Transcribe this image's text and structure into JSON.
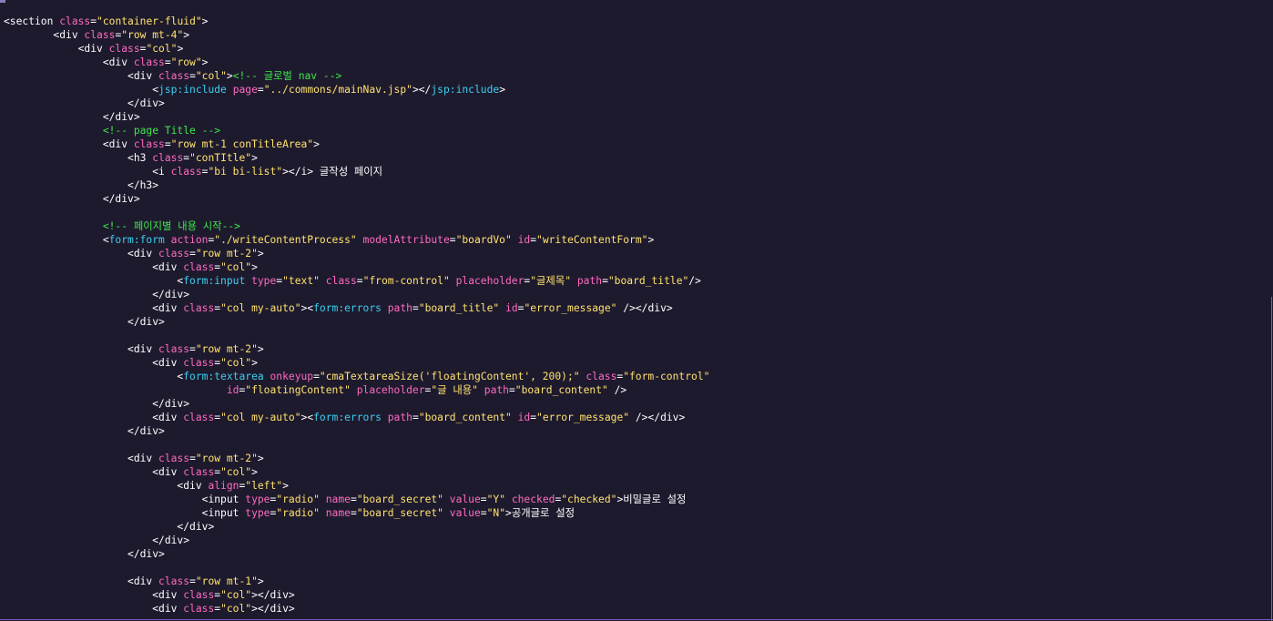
{
  "editor": {
    "lines": [
      [
        [
          "t",
          "<section "
        ],
        [
          "a",
          "class"
        ],
        [
          "t",
          "="
        ],
        [
          "s",
          "\"container-fluid\""
        ],
        [
          "t",
          ">"
        ]
      ],
      [
        [
          "t",
          "        <div "
        ],
        [
          "a",
          "class"
        ],
        [
          "t",
          "="
        ],
        [
          "s",
          "\"row mt-4\""
        ],
        [
          "t",
          ">"
        ]
      ],
      [
        [
          "t",
          "            <div "
        ],
        [
          "a",
          "class"
        ],
        [
          "t",
          "="
        ],
        [
          "s",
          "\"col\""
        ],
        [
          "t",
          ">"
        ]
      ],
      [
        [
          "t",
          "                <div "
        ],
        [
          "a",
          "class"
        ],
        [
          "t",
          "="
        ],
        [
          "s",
          "\"row\""
        ],
        [
          "t",
          ">"
        ]
      ],
      [
        [
          "t",
          "                    <div "
        ],
        [
          "a",
          "class"
        ],
        [
          "t",
          "="
        ],
        [
          "s",
          "\"col\""
        ],
        [
          "t",
          ">"
        ],
        [
          "c",
          "<!-- 글로벌 nav -->"
        ]
      ],
      [
        [
          "t",
          "                        <"
        ],
        [
          "j",
          "jsp:include"
        ],
        [
          "t",
          " "
        ],
        [
          "a",
          "page"
        ],
        [
          "t",
          "="
        ],
        [
          "s",
          "\"../commons/mainNav.jsp\""
        ],
        [
          "t",
          "></"
        ],
        [
          "j",
          "jsp:include"
        ],
        [
          "t",
          ">"
        ]
      ],
      [
        [
          "t",
          "                    </div>"
        ]
      ],
      [
        [
          "t",
          "                </div>"
        ]
      ],
      [
        [
          "c",
          "                <!-- page Title -->"
        ]
      ],
      [
        [
          "t",
          "                <div "
        ],
        [
          "a",
          "class"
        ],
        [
          "t",
          "="
        ],
        [
          "s",
          "\"row mt-1 conTitleArea\""
        ],
        [
          "t",
          ">"
        ]
      ],
      [
        [
          "t",
          "                    <h3 "
        ],
        [
          "a",
          "class"
        ],
        [
          "t",
          "="
        ],
        [
          "s",
          "\"conTItle\""
        ],
        [
          "t",
          ">"
        ]
      ],
      [
        [
          "t",
          "                        <i "
        ],
        [
          "a",
          "class"
        ],
        [
          "t",
          "="
        ],
        [
          "s",
          "\"bi bi-list\""
        ],
        [
          "t",
          "></i> 글작성 페이지"
        ]
      ],
      [
        [
          "t",
          "                    </h3>"
        ]
      ],
      [
        [
          "t",
          "                </div>"
        ]
      ],
      [
        [
          "t",
          ""
        ]
      ],
      [
        [
          "c",
          "                <!-- 페이지별 내용 시작-->"
        ]
      ],
      [
        [
          "t",
          "                <"
        ],
        [
          "j",
          "form:form"
        ],
        [
          "t",
          " "
        ],
        [
          "a",
          "action"
        ],
        [
          "t",
          "="
        ],
        [
          "s",
          "\"./writeContentProcess\""
        ],
        [
          "t",
          " "
        ],
        [
          "a",
          "modelAttribute"
        ],
        [
          "t",
          "="
        ],
        [
          "s",
          "\"boardVo\""
        ],
        [
          "t",
          " "
        ],
        [
          "a",
          "id"
        ],
        [
          "t",
          "="
        ],
        [
          "s",
          "\"writeContentForm\""
        ],
        [
          "t",
          ">"
        ]
      ],
      [
        [
          "t",
          "                    <div "
        ],
        [
          "a",
          "class"
        ],
        [
          "t",
          "="
        ],
        [
          "s",
          "\"row mt-2\""
        ],
        [
          "t",
          ">"
        ]
      ],
      [
        [
          "t",
          "                        <div "
        ],
        [
          "a",
          "class"
        ],
        [
          "t",
          "="
        ],
        [
          "s",
          "\"col\""
        ],
        [
          "t",
          ">"
        ]
      ],
      [
        [
          "t",
          "                            <"
        ],
        [
          "j",
          "form:input"
        ],
        [
          "t",
          " "
        ],
        [
          "a",
          "type"
        ],
        [
          "t",
          "="
        ],
        [
          "s",
          "\"text\""
        ],
        [
          "t",
          " "
        ],
        [
          "a",
          "class"
        ],
        [
          "t",
          "="
        ],
        [
          "s",
          "\"from-control\""
        ],
        [
          "t",
          " "
        ],
        [
          "a",
          "placeholder"
        ],
        [
          "t",
          "="
        ],
        [
          "s",
          "\"글제목\""
        ],
        [
          "t",
          " "
        ],
        [
          "a",
          "path"
        ],
        [
          "t",
          "="
        ],
        [
          "s",
          "\"board_title\""
        ],
        [
          "t",
          "/>"
        ]
      ],
      [
        [
          "t",
          "                        </div>"
        ]
      ],
      [
        [
          "t",
          "                        <div "
        ],
        [
          "a",
          "class"
        ],
        [
          "t",
          "="
        ],
        [
          "s",
          "\"col my-auto\""
        ],
        [
          "t",
          "><"
        ],
        [
          "j",
          "form:errors"
        ],
        [
          "t",
          " "
        ],
        [
          "a",
          "path"
        ],
        [
          "t",
          "="
        ],
        [
          "s",
          "\"board_title\""
        ],
        [
          "t",
          " "
        ],
        [
          "a",
          "id"
        ],
        [
          "t",
          "="
        ],
        [
          "s",
          "\"error_message\""
        ],
        [
          "t",
          " /></div>"
        ]
      ],
      [
        [
          "t",
          "                    </div>"
        ]
      ],
      [
        [
          "t",
          ""
        ]
      ],
      [
        [
          "t",
          "                    <div "
        ],
        [
          "a",
          "class"
        ],
        [
          "t",
          "="
        ],
        [
          "s",
          "\"row mt-2\""
        ],
        [
          "t",
          ">"
        ]
      ],
      [
        [
          "t",
          "                        <div "
        ],
        [
          "a",
          "class"
        ],
        [
          "t",
          "="
        ],
        [
          "s",
          "\"col\""
        ],
        [
          "t",
          ">"
        ]
      ],
      [
        [
          "t",
          "                            <"
        ],
        [
          "j",
          "form:textarea"
        ],
        [
          "t",
          " "
        ],
        [
          "a",
          "onkeyup"
        ],
        [
          "t",
          "="
        ],
        [
          "s",
          "\"cmaTextareaSize('floatingContent', 200);\""
        ],
        [
          "t",
          " "
        ],
        [
          "a",
          "class"
        ],
        [
          "t",
          "="
        ],
        [
          "s",
          "\"form-control\""
        ]
      ],
      [
        [
          "t",
          "                                    "
        ],
        [
          "a",
          "id"
        ],
        [
          "t",
          "="
        ],
        [
          "s",
          "\"floatingContent\""
        ],
        [
          "t",
          " "
        ],
        [
          "a",
          "placeholder"
        ],
        [
          "t",
          "="
        ],
        [
          "s",
          "\"글 내용\""
        ],
        [
          "t",
          " "
        ],
        [
          "a",
          "path"
        ],
        [
          "t",
          "="
        ],
        [
          "s",
          "\"board_content\""
        ],
        [
          "t",
          " />"
        ]
      ],
      [
        [
          "t",
          "                        </div>"
        ]
      ],
      [
        [
          "t",
          "                        <div "
        ],
        [
          "a",
          "class"
        ],
        [
          "t",
          "="
        ],
        [
          "s",
          "\"col my-auto\""
        ],
        [
          "t",
          "><"
        ],
        [
          "j",
          "form:errors"
        ],
        [
          "t",
          " "
        ],
        [
          "a",
          "path"
        ],
        [
          "t",
          "="
        ],
        [
          "s",
          "\"board_content\""
        ],
        [
          "t",
          " "
        ],
        [
          "a",
          "id"
        ],
        [
          "t",
          "="
        ],
        [
          "s",
          "\"error_message\""
        ],
        [
          "t",
          " /></div>"
        ]
      ],
      [
        [
          "t",
          "                    </div>"
        ]
      ],
      [
        [
          "t",
          ""
        ]
      ],
      [
        [
          "t",
          "                    <div "
        ],
        [
          "a",
          "class"
        ],
        [
          "t",
          "="
        ],
        [
          "s",
          "\"row mt-2\""
        ],
        [
          "t",
          ">"
        ]
      ],
      [
        [
          "t",
          "                        <div "
        ],
        [
          "a",
          "class"
        ],
        [
          "t",
          "="
        ],
        [
          "s",
          "\"col\""
        ],
        [
          "t",
          ">"
        ]
      ],
      [
        [
          "t",
          "                            <div "
        ],
        [
          "a",
          "align"
        ],
        [
          "t",
          "="
        ],
        [
          "s",
          "\"left\""
        ],
        [
          "t",
          ">"
        ]
      ],
      [
        [
          "t",
          "                                <input "
        ],
        [
          "a",
          "type"
        ],
        [
          "t",
          "="
        ],
        [
          "s",
          "\"radio\""
        ],
        [
          "t",
          " "
        ],
        [
          "a",
          "name"
        ],
        [
          "t",
          "="
        ],
        [
          "s",
          "\"board_secret\""
        ],
        [
          "t",
          " "
        ],
        [
          "a",
          "value"
        ],
        [
          "t",
          "="
        ],
        [
          "s",
          "\"Y\""
        ],
        [
          "t",
          " "
        ],
        [
          "a",
          "checked"
        ],
        [
          "t",
          "="
        ],
        [
          "s",
          "\"checked\""
        ],
        [
          "t",
          ">비밀글로 설정"
        ]
      ],
      [
        [
          "t",
          "                                <input "
        ],
        [
          "a",
          "type"
        ],
        [
          "t",
          "="
        ],
        [
          "s",
          "\"radio\""
        ],
        [
          "t",
          " "
        ],
        [
          "a",
          "name"
        ],
        [
          "t",
          "="
        ],
        [
          "s",
          "\"board_secret\""
        ],
        [
          "t",
          " "
        ],
        [
          "a",
          "value"
        ],
        [
          "t",
          "="
        ],
        [
          "s",
          "\"N\""
        ],
        [
          "t",
          ">공개글로 설정"
        ]
      ],
      [
        [
          "t",
          "                            </div>"
        ]
      ],
      [
        [
          "t",
          "                        </div>"
        ]
      ],
      [
        [
          "t",
          "                    </div>"
        ]
      ],
      [
        [
          "t",
          ""
        ]
      ],
      [
        [
          "t",
          "                    <div "
        ],
        [
          "a",
          "class"
        ],
        [
          "t",
          "="
        ],
        [
          "s",
          "\"row mt-1\""
        ],
        [
          "t",
          ">"
        ]
      ],
      [
        [
          "t",
          "                        <div "
        ],
        [
          "a",
          "class"
        ],
        [
          "t",
          "="
        ],
        [
          "s",
          "\"col\""
        ],
        [
          "t",
          "></div>"
        ]
      ],
      [
        [
          "t",
          "                        <div "
        ],
        [
          "a",
          "class"
        ],
        [
          "t",
          "="
        ],
        [
          "s",
          "\"col\""
        ],
        [
          "t",
          "></div>"
        ]
      ]
    ]
  },
  "colors": {
    "background": "#1e1a2e",
    "text": "#ffffff",
    "attribute": "#ff6ac1",
    "string": "#ffe36e",
    "comment": "#3ee84a",
    "namespace_tag": "#3ad0f0",
    "border": "#7a5ac8"
  }
}
